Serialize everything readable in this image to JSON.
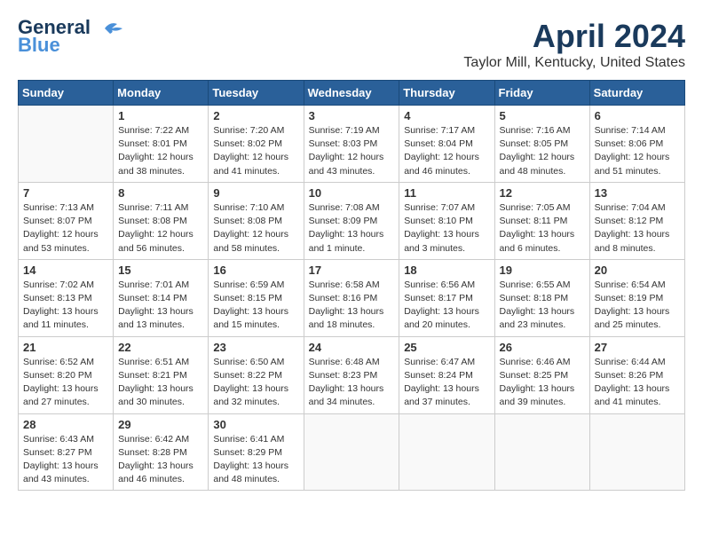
{
  "header": {
    "logo_line1": "General",
    "logo_line2": "Blue",
    "month": "April 2024",
    "location": "Taylor Mill, Kentucky, United States"
  },
  "weekdays": [
    "Sunday",
    "Monday",
    "Tuesday",
    "Wednesday",
    "Thursday",
    "Friday",
    "Saturday"
  ],
  "weeks": [
    [
      {
        "day": "",
        "info": ""
      },
      {
        "day": "1",
        "info": "Sunrise: 7:22 AM\nSunset: 8:01 PM\nDaylight: 12 hours\nand 38 minutes."
      },
      {
        "day": "2",
        "info": "Sunrise: 7:20 AM\nSunset: 8:02 PM\nDaylight: 12 hours\nand 41 minutes."
      },
      {
        "day": "3",
        "info": "Sunrise: 7:19 AM\nSunset: 8:03 PM\nDaylight: 12 hours\nand 43 minutes."
      },
      {
        "day": "4",
        "info": "Sunrise: 7:17 AM\nSunset: 8:04 PM\nDaylight: 12 hours\nand 46 minutes."
      },
      {
        "day": "5",
        "info": "Sunrise: 7:16 AM\nSunset: 8:05 PM\nDaylight: 12 hours\nand 48 minutes."
      },
      {
        "day": "6",
        "info": "Sunrise: 7:14 AM\nSunset: 8:06 PM\nDaylight: 12 hours\nand 51 minutes."
      }
    ],
    [
      {
        "day": "7",
        "info": "Sunrise: 7:13 AM\nSunset: 8:07 PM\nDaylight: 12 hours\nand 53 minutes."
      },
      {
        "day": "8",
        "info": "Sunrise: 7:11 AM\nSunset: 8:08 PM\nDaylight: 12 hours\nand 56 minutes."
      },
      {
        "day": "9",
        "info": "Sunrise: 7:10 AM\nSunset: 8:08 PM\nDaylight: 12 hours\nand 58 minutes."
      },
      {
        "day": "10",
        "info": "Sunrise: 7:08 AM\nSunset: 8:09 PM\nDaylight: 13 hours\nand 1 minute."
      },
      {
        "day": "11",
        "info": "Sunrise: 7:07 AM\nSunset: 8:10 PM\nDaylight: 13 hours\nand 3 minutes."
      },
      {
        "day": "12",
        "info": "Sunrise: 7:05 AM\nSunset: 8:11 PM\nDaylight: 13 hours\nand 6 minutes."
      },
      {
        "day": "13",
        "info": "Sunrise: 7:04 AM\nSunset: 8:12 PM\nDaylight: 13 hours\nand 8 minutes."
      }
    ],
    [
      {
        "day": "14",
        "info": "Sunrise: 7:02 AM\nSunset: 8:13 PM\nDaylight: 13 hours\nand 11 minutes."
      },
      {
        "day": "15",
        "info": "Sunrise: 7:01 AM\nSunset: 8:14 PM\nDaylight: 13 hours\nand 13 minutes."
      },
      {
        "day": "16",
        "info": "Sunrise: 6:59 AM\nSunset: 8:15 PM\nDaylight: 13 hours\nand 15 minutes."
      },
      {
        "day": "17",
        "info": "Sunrise: 6:58 AM\nSunset: 8:16 PM\nDaylight: 13 hours\nand 18 minutes."
      },
      {
        "day": "18",
        "info": "Sunrise: 6:56 AM\nSunset: 8:17 PM\nDaylight: 13 hours\nand 20 minutes."
      },
      {
        "day": "19",
        "info": "Sunrise: 6:55 AM\nSunset: 8:18 PM\nDaylight: 13 hours\nand 23 minutes."
      },
      {
        "day": "20",
        "info": "Sunrise: 6:54 AM\nSunset: 8:19 PM\nDaylight: 13 hours\nand 25 minutes."
      }
    ],
    [
      {
        "day": "21",
        "info": "Sunrise: 6:52 AM\nSunset: 8:20 PM\nDaylight: 13 hours\nand 27 minutes."
      },
      {
        "day": "22",
        "info": "Sunrise: 6:51 AM\nSunset: 8:21 PM\nDaylight: 13 hours\nand 30 minutes."
      },
      {
        "day": "23",
        "info": "Sunrise: 6:50 AM\nSunset: 8:22 PM\nDaylight: 13 hours\nand 32 minutes."
      },
      {
        "day": "24",
        "info": "Sunrise: 6:48 AM\nSunset: 8:23 PM\nDaylight: 13 hours\nand 34 minutes."
      },
      {
        "day": "25",
        "info": "Sunrise: 6:47 AM\nSunset: 8:24 PM\nDaylight: 13 hours\nand 37 minutes."
      },
      {
        "day": "26",
        "info": "Sunrise: 6:46 AM\nSunset: 8:25 PM\nDaylight: 13 hours\nand 39 minutes."
      },
      {
        "day": "27",
        "info": "Sunrise: 6:44 AM\nSunset: 8:26 PM\nDaylight: 13 hours\nand 41 minutes."
      }
    ],
    [
      {
        "day": "28",
        "info": "Sunrise: 6:43 AM\nSunset: 8:27 PM\nDaylight: 13 hours\nand 43 minutes."
      },
      {
        "day": "29",
        "info": "Sunrise: 6:42 AM\nSunset: 8:28 PM\nDaylight: 13 hours\nand 46 minutes."
      },
      {
        "day": "30",
        "info": "Sunrise: 6:41 AM\nSunset: 8:29 PM\nDaylight: 13 hours\nand 48 minutes."
      },
      {
        "day": "",
        "info": ""
      },
      {
        "day": "",
        "info": ""
      },
      {
        "day": "",
        "info": ""
      },
      {
        "day": "",
        "info": ""
      }
    ]
  ]
}
